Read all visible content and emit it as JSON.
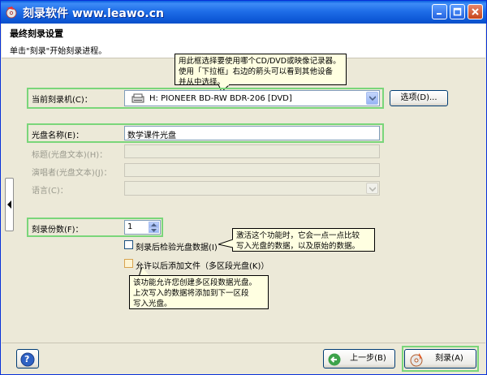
{
  "window": {
    "title": "刻录软件 www.leawo.cn"
  },
  "header": {
    "title": "最终刻录设置",
    "subtitle": "单击\"刻录\"开始刻录进程。"
  },
  "tooltip_top": {
    "lines": [
      "用此框选择要使用哪个CD/DVD或映像记录器。",
      "使用「下拉框」右边的箭头可以看到其他设备",
      "并从中选择。"
    ]
  },
  "burner": {
    "label": "当前刻录机(C)：",
    "value": "H: PIONEER BD-RW   BDR-206   [DVD]",
    "options_button": "选项(D)..."
  },
  "disc_name": {
    "label": "光盘名称(E)：",
    "value": "数学课件光盘"
  },
  "title_field": {
    "label": "标题(光盘文本)(H)：",
    "value": ""
  },
  "performer": {
    "label": "演唱者(光盘文本)(J)：",
    "value": ""
  },
  "language": {
    "label": "语言(C)：",
    "value": ""
  },
  "copies": {
    "label": "刻录份数(F)：",
    "value": "1"
  },
  "verify": {
    "label": "刻录后检验光盘数据(I)",
    "checked": false
  },
  "tooltip_verify": {
    "lines": [
      "激活这个功能时，它会一点一点比较",
      "写入光盘的数据，以及原始的数据。"
    ]
  },
  "multisession": {
    "label": "允许以后添加文件（多区段光盘(K)）",
    "checked": false
  },
  "tooltip_multi": {
    "lines": [
      "该功能允许您创建多区段数据光盘。",
      "上次写入的数据将添加到下一区段",
      "写入光盘。"
    ]
  },
  "footer": {
    "help": "?",
    "back": "上一步(B)",
    "burn": "刻录(A)"
  },
  "colors": {
    "highlight_border": "#7ad67a",
    "titlebar": "#0f5ad8",
    "dialog_bg": "#ece9d8"
  }
}
